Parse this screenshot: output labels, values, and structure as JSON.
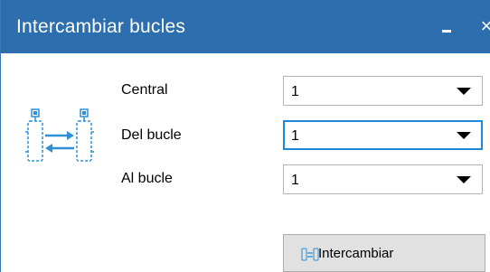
{
  "window": {
    "title": "Intercambiar bucles",
    "minimize_glyph": "_",
    "close_glyph": "×"
  },
  "form": {
    "central_label": "Central",
    "central_value": "1",
    "del_bucle_label": "Del bucle",
    "del_bucle_value": "1",
    "al_bucle_label": "Al bucle",
    "al_bucle_value": "1"
  },
  "actions": {
    "swap_label": "Intercambiar"
  },
  "icons": {
    "illustration": "loop-swap-icon",
    "button_icon": "swap-icon"
  },
  "colors": {
    "titlebar": "#2d6fae",
    "focus_border": "#1c8ad8",
    "icon_blue": "#2d8fd6"
  }
}
